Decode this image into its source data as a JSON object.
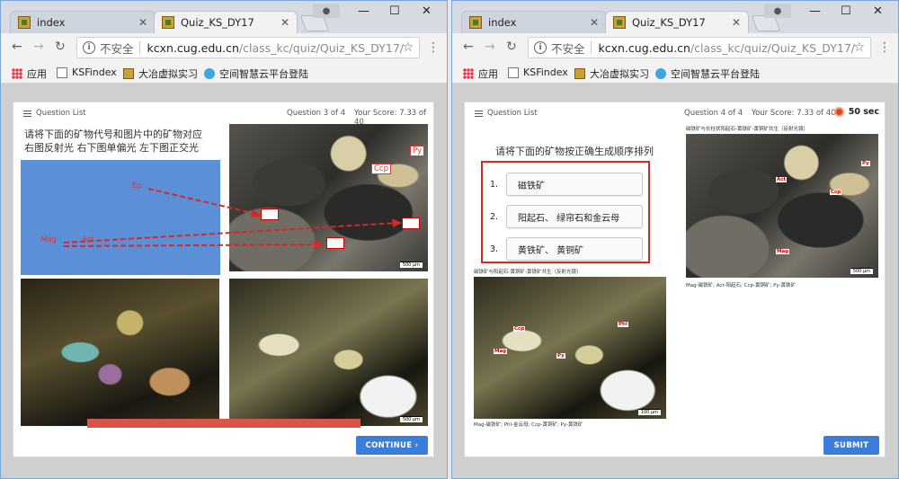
{
  "left": {
    "tabs": [
      {
        "title": "index"
      },
      {
        "title": "Quiz_KS_DY17"
      }
    ],
    "address": {
      "insecure": "不安全",
      "host": "kcxn.cug.edu.cn",
      "path": "/class_kc/quiz/Quiz_KS_DY17/"
    },
    "bookmarks": [
      "应用",
      "KSFindex",
      "大冶虚拟实习",
      "空间智慧云平台登陆"
    ],
    "quiz": {
      "question_list": "Question List",
      "progress": "Question 3 of 4",
      "score": "Your Score: 7.33 of 40",
      "prompt_line1": "请将下面的矿物代号和图片中的矿物对应",
      "prompt_line2": "右图反射光  右下图单偏光  左下图正交光",
      "drag_labels": [
        "Ep",
        "Mag",
        "Act"
      ],
      "image_labels": [
        "Ccp",
        "Py"
      ],
      "scale": "500 μm",
      "button": "CONTINUE ›"
    }
  },
  "right": {
    "tabs": [
      {
        "title": "index"
      },
      {
        "title": "Quiz_KS_DY17"
      }
    ],
    "address": {
      "insecure": "不安全",
      "host": "kcxn.cug.edu.cn",
      "path": "/class_kc/quiz/Quiz_KS_DY17/"
    },
    "bookmarks": [
      "应用",
      "KSFindex",
      "大冶虚拟实习",
      "空间智慧云平台登陆"
    ],
    "quiz": {
      "question_list": "Question List",
      "progress": "Question 4 of 4",
      "score": "Your Score: 7.33 of 40",
      "timer": "50 sec",
      "prompt": "请将下面的矿物按正确生成顺序排列",
      "items": [
        {
          "num": "1.",
          "label": "磁铁矿"
        },
        {
          "num": "2.",
          "label": "阳起石、 绿帘石和金云母"
        },
        {
          "num": "3.",
          "label": "黄铁矿、 黄铜矿"
        }
      ],
      "img_top_title": "磁铁矿与长柱状阳起石-黄铁矿-黄铜矿共生（反射光镜）",
      "img_top_caption": "Mag-磁铁矿; Act-阳起石; Ccp-黄铜矿; Py-黄铁矿",
      "img_top_labels": [
        "Py",
        "Act",
        "Ccp",
        "Mag"
      ],
      "img_bottom_title": "磁铁矿与阳起石-黄铜矿-黄铁矿共生（反射光镜）",
      "img_bottom_caption": "Mag-磁铁矿; Phl-金云母; Ccp-黄铜矿; Py-黄铁矿",
      "img_bottom_labels": [
        "Ccp",
        "Mag",
        "Py",
        "Phl"
      ],
      "scale_top": "500 μm",
      "scale_bottom": "100 μm",
      "button": "SUBMIT"
    }
  },
  "colors": {
    "accent": "#3a7ddb",
    "highlight": "#d12a2a",
    "arrow": "#d62828"
  }
}
